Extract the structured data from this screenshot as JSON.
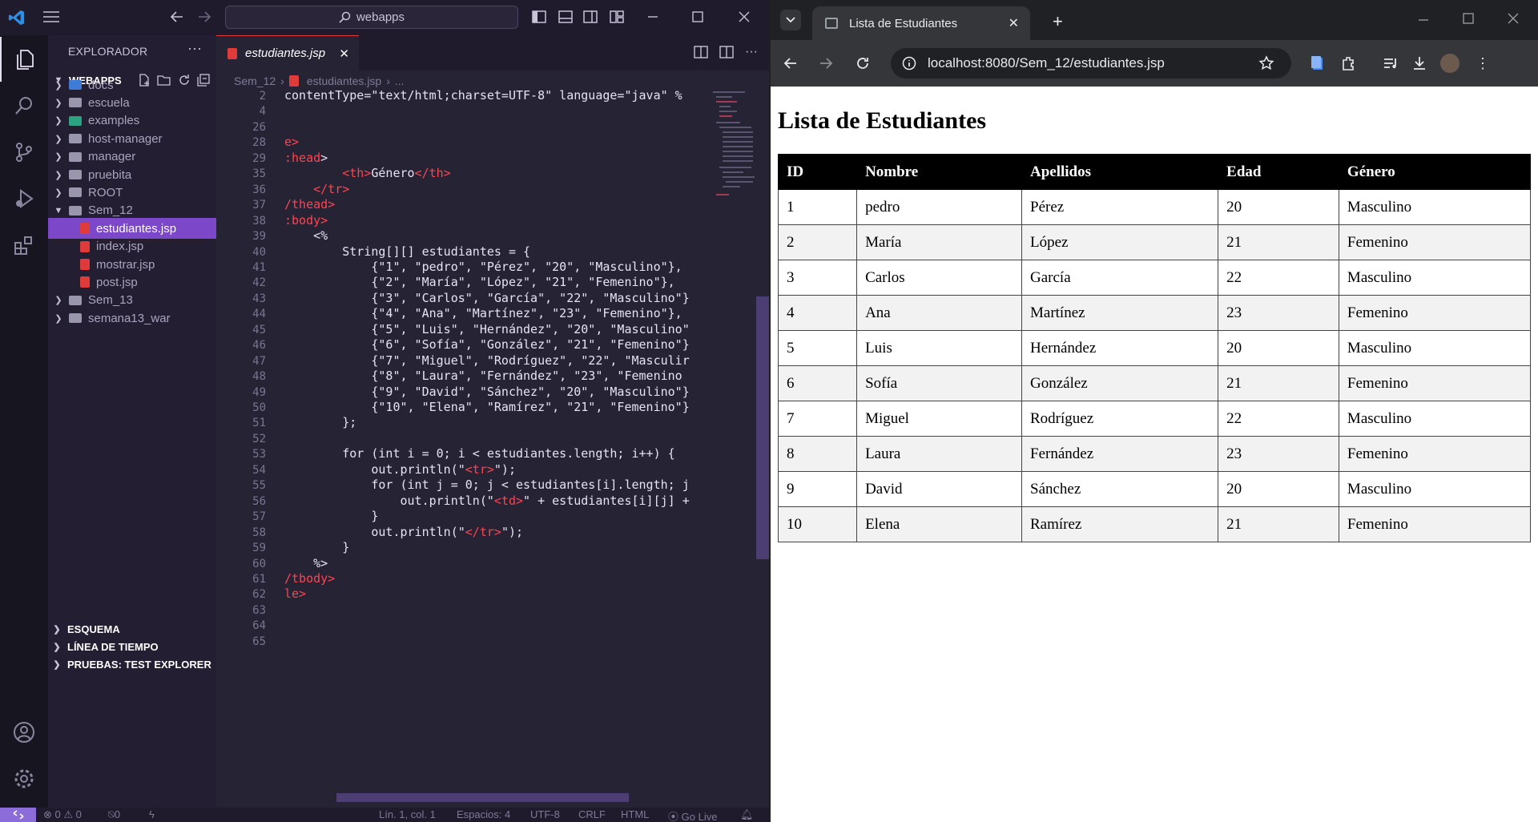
{
  "vscode": {
    "command_center": "webapps",
    "explorer_title": "EXPLORADOR",
    "workspace": "WEBAPPS",
    "tree": [
      {
        "label": "docs",
        "type": "folder",
        "variant": "blue",
        "indent": 1,
        "expanded": false
      },
      {
        "label": "escuela",
        "type": "folder",
        "variant": "plain",
        "indent": 1,
        "expanded": false
      },
      {
        "label": "examples",
        "type": "folder",
        "variant": "green",
        "indent": 1,
        "expanded": false
      },
      {
        "label": "host-manager",
        "type": "folder",
        "variant": "plain",
        "indent": 1,
        "expanded": false
      },
      {
        "label": "manager",
        "type": "folder",
        "variant": "plain",
        "indent": 1,
        "expanded": false
      },
      {
        "label": "pruebita",
        "type": "folder",
        "variant": "plain",
        "indent": 1,
        "expanded": false
      },
      {
        "label": "ROOT",
        "type": "folder",
        "variant": "plain",
        "indent": 1,
        "expanded": false
      },
      {
        "label": "Sem_12",
        "type": "folder",
        "variant": "plain",
        "indent": 1,
        "expanded": true
      },
      {
        "label": "estudiantes.jsp",
        "type": "jsp",
        "indent": 2,
        "selected": true
      },
      {
        "label": "index.jsp",
        "type": "jsp",
        "indent": 2
      },
      {
        "label": "mostrar.jsp",
        "type": "jsp",
        "indent": 2
      },
      {
        "label": "post.jsp",
        "type": "jsp",
        "indent": 2
      },
      {
        "label": "Sem_13",
        "type": "folder",
        "variant": "plain",
        "indent": 1,
        "expanded": false
      },
      {
        "label": "semana13_war",
        "type": "folder",
        "variant": "plain",
        "indent": 1,
        "expanded": false
      }
    ],
    "bottom_sections": [
      "ESQUEMA",
      "LÍNEA DE TIEMPO",
      "PRUEBAS: TEST EXPLORER"
    ],
    "active_tab": "estudiantes.jsp",
    "breadcrumb": {
      "folder": "Sem_12",
      "file": "estudiantes.jsp",
      "rest": "..."
    },
    "line_numbers": [
      "2",
      "4",
      "26",
      "28",
      "29",
      "35",
      "36",
      "37",
      "38",
      "39",
      "40",
      "41",
      "42",
      "43",
      "44",
      "45",
      "46",
      "47",
      "48",
      "49",
      "50",
      "51",
      "52",
      "53",
      "54",
      "55",
      "56",
      "57",
      "58",
      "59",
      "60",
      "61",
      "62",
      "63",
      "64",
      "65"
    ],
    "code_lines": [
      [
        {
          "t": "contentType=\"text/html;charset=UTF-8\" language=\"java\" %"
        }
      ],
      [],
      [],
      [
        {
          "t": "e>",
          "c": "tag"
        }
      ],
      [
        {
          "t": ":head",
          "c": "tag"
        },
        {
          "t": ">"
        }
      ],
      [
        {
          "t": "        "
        },
        {
          "t": "<th>",
          "c": "tag"
        },
        {
          "t": "Género"
        },
        {
          "t": "</th>",
          "c": "tag"
        }
      ],
      [
        {
          "t": "    "
        },
        {
          "t": "</tr>",
          "c": "tag"
        }
      ],
      [
        {
          "t": "/thead>",
          "c": "tag"
        }
      ],
      [
        {
          "t": ":body>",
          "c": "tag"
        }
      ],
      [
        {
          "t": "    <%"
        }
      ],
      [
        {
          "t": "        String[][] estudiantes = {"
        }
      ],
      [
        {
          "t": "            {\"1\", \"pedro\", \"Pérez\", \"20\", \"Masculino\"},"
        }
      ],
      [
        {
          "t": "            {\"2\", \"María\", \"López\", \"21\", \"Femenino\"},"
        }
      ],
      [
        {
          "t": "            {\"3\", \"Carlos\", \"García\", \"22\", \"Masculino\"}"
        }
      ],
      [
        {
          "t": "            {\"4\", \"Ana\", \"Martínez\", \"23\", \"Femenino\"},"
        }
      ],
      [
        {
          "t": "            {\"5\", \"Luis\", \"Hernández\", \"20\", \"Masculino\""
        }
      ],
      [
        {
          "t": "            {\"6\", \"Sofía\", \"González\", \"21\", \"Femenino\"}"
        }
      ],
      [
        {
          "t": "            {\"7\", \"Miguel\", \"Rodríguez\", \"22\", \"Masculir"
        }
      ],
      [
        {
          "t": "            {\"8\", \"Laura\", \"Fernández\", \"23\", \"Femenino"
        }
      ],
      [
        {
          "t": "            {\"9\", \"David\", \"Sánchez\", \"20\", \"Masculino\"}"
        }
      ],
      [
        {
          "t": "            {\"10\", \"Elena\", \"Ramírez\", \"21\", \"Femenino\"}"
        }
      ],
      [
        {
          "t": "        };"
        }
      ],
      [],
      [
        {
          "t": "        for (int i = 0; i < estudiantes.length; i++) {"
        }
      ],
      [
        {
          "t": "            out.println(\""
        },
        {
          "t": "<tr>",
          "c": "tag"
        },
        {
          "t": "\");"
        }
      ],
      [
        {
          "t": "            for (int j = 0; j < estudiantes[i].length; j"
        }
      ],
      [
        {
          "t": "                out.println(\""
        },
        {
          "t": "<td>",
          "c": "tag"
        },
        {
          "t": "\" + estudiantes[i][j] +"
        }
      ],
      [
        {
          "t": "            }"
        }
      ],
      [
        {
          "t": "            out.println(\""
        },
        {
          "t": "</tr>",
          "c": "tag"
        },
        {
          "t": "\");"
        }
      ],
      [
        {
          "t": "        }"
        }
      ],
      [
        {
          "t": "    %>"
        }
      ],
      [
        {
          "t": "/tbody>",
          "c": "tag"
        }
      ],
      [
        {
          "t": "le>",
          "c": "tag"
        }
      ],
      [],
      [],
      []
    ],
    "status": {
      "errors": "0",
      "warnings": "0",
      "ports": "0",
      "position": "Lín. 1, col. 1",
      "spaces": "Espacios: 4",
      "encoding": "UTF-8",
      "eol": "CRLF",
      "language": "HTML",
      "golive": "Go Live"
    }
  },
  "browser": {
    "tab_title": "Lista de Estudiantes",
    "url": "localhost:8080/Sem_12/estudiantes.jsp",
    "page": {
      "heading": "Lista de Estudiantes",
      "columns": [
        "ID",
        "Nombre",
        "Apellidos",
        "Edad",
        "Género"
      ],
      "rows": [
        [
          "1",
          "pedro",
          "Pérez",
          "20",
          "Masculino"
        ],
        [
          "2",
          "María",
          "López",
          "21",
          "Femenino"
        ],
        [
          "3",
          "Carlos",
          "García",
          "22",
          "Masculino"
        ],
        [
          "4",
          "Ana",
          "Martínez",
          "23",
          "Femenino"
        ],
        [
          "5",
          "Luis",
          "Hernández",
          "20",
          "Masculino"
        ],
        [
          "6",
          "Sofía",
          "González",
          "21",
          "Femenino"
        ],
        [
          "7",
          "Miguel",
          "Rodríguez",
          "22",
          "Masculino"
        ],
        [
          "8",
          "Laura",
          "Fernández",
          "23",
          "Femenino"
        ],
        [
          "9",
          "David",
          "Sánchez",
          "20",
          "Masculino"
        ],
        [
          "10",
          "Elena",
          "Ramírez",
          "21",
          "Femenino"
        ]
      ]
    }
  },
  "colors": {
    "vscode_accent": "#7c47c8",
    "tag": "#fe4450",
    "table_header": "#000000"
  }
}
